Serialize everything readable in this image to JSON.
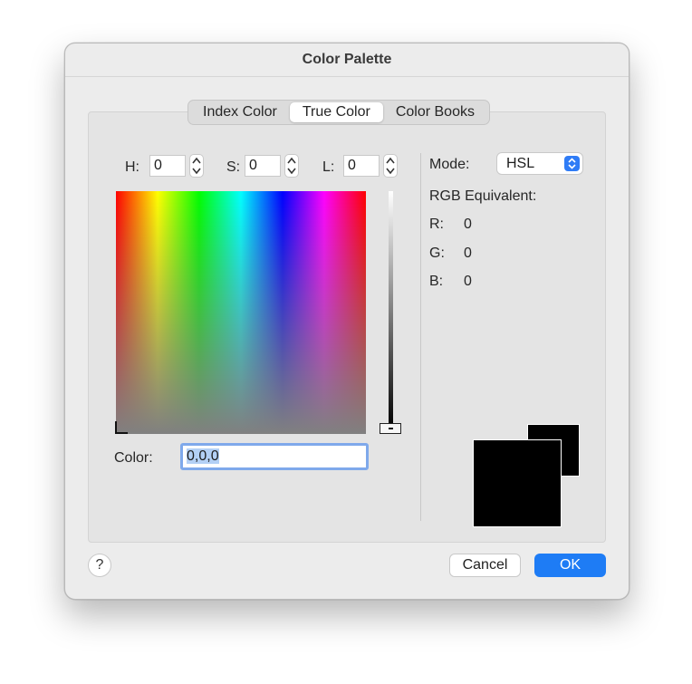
{
  "dialog": {
    "title": "Color Palette"
  },
  "tabs": [
    {
      "label": "Index Color",
      "active": false
    },
    {
      "label": "True Color",
      "active": true
    },
    {
      "label": "Color Books",
      "active": false
    }
  ],
  "hsl": {
    "h_label": "H:",
    "h_value": "0",
    "s_label": "S:",
    "s_value": "0",
    "l_label": "L:",
    "l_value": "0"
  },
  "color_field": {
    "label": "Color:",
    "value": "0,0,0"
  },
  "mode": {
    "label": "Mode:",
    "value": "HSL"
  },
  "rgb": {
    "title": "RGB Equivalent:",
    "r_label": "R:",
    "r_value": "0",
    "g_label": "G:",
    "g_value": "0",
    "b_label": "B:",
    "b_value": "0"
  },
  "swatch": {
    "new_color": "#000000",
    "current_color": "#000000"
  },
  "buttons": {
    "help": "?",
    "cancel": "Cancel",
    "ok": "OK"
  },
  "colors": {
    "accent": "#1e7cf5",
    "focus_ring": "#7fa9eb"
  }
}
